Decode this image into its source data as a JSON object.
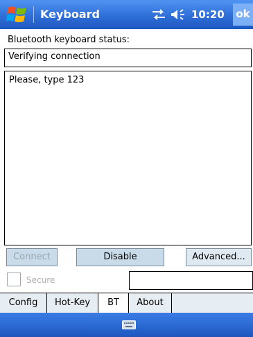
{
  "app": {
    "title": "Keyboard",
    "time": "10:20",
    "ok_label": "ok"
  },
  "icons": {
    "start": "windows-flag-icon",
    "connectivity": "connectivity-arrows-icon",
    "volume": "speaker-volume-icon",
    "keyboard": "keyboard-icon"
  },
  "status": {
    "label": "Bluetooth keyboard status:",
    "value": "Verifying connection"
  },
  "input": {
    "text": "Please, type 123"
  },
  "buttons": {
    "connect": "Connect",
    "disable": "Disable",
    "advanced": "Advanced..."
  },
  "secure": {
    "label": "Secure",
    "checked": false,
    "value": ""
  },
  "tabs": [
    {
      "label": "Config",
      "active": false
    },
    {
      "label": "Hot-Key",
      "active": false
    },
    {
      "label": "BT",
      "active": true
    },
    {
      "label": "About",
      "active": false
    }
  ],
  "colors": {
    "titlebar": "#2f6fd8",
    "button": "#c9dbe8",
    "tab": "#e6edf3"
  }
}
